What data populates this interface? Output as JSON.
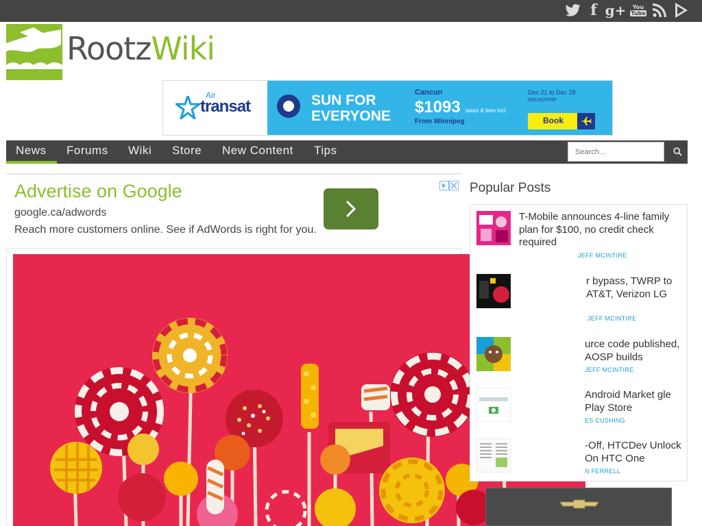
{
  "social": [
    "twitter-icon",
    "facebook-icon",
    "google-plus-icon",
    "youtube-icon",
    "rss-icon",
    "play-store-icon"
  ],
  "social_text": {
    "facebook": "f",
    "google_plus": "g+",
    "youtube_top": "You",
    "youtube_bottom": "Tube"
  },
  "logo": {
    "rootz": "Rootz",
    "wiki": "Wiki"
  },
  "banner": {
    "air": "Air",
    "brand": "transat",
    "headline_1": "SUN FOR",
    "headline_2": "EVERYONE",
    "destination": "Cancun",
    "price": "$1093",
    "price_note": "taxes & fees incl.",
    "origin": "From Winnipeg",
    "dates": "Dec 21 to Dec 28",
    "trip_type": "ROUNDTRIP",
    "button": "Book"
  },
  "nav": {
    "items": [
      "News",
      "Forums",
      "Wiki",
      "Store",
      "New Content",
      "Tips"
    ],
    "active_index": 0,
    "search_placeholder": "Search..."
  },
  "ad": {
    "title": "Advertise on Google",
    "url": "google.ca/adwords",
    "description": "Reach more customers online. See if AdWords is right for you."
  },
  "popular": {
    "title": "Popular Posts",
    "items": [
      {
        "title": "T-Mobile announces 4-line family plan for $100, no credit check required",
        "meta": "JEFF MCINTIRE"
      },
      {
        "title": "r bypass, TWRP to AT&T, Verizon LG",
        "meta": "JEFF MCINTIRE"
      },
      {
        "title": "urce code published, AOSP builds",
        "meta": "JEFF MCINTIRE"
      },
      {
        "title": "Android Market gle Play Store",
        "meta": "ES CUSHING"
      },
      {
        "title": "-Off, HTCDev Unlock On HTC One",
        "meta": "N FERRELL"
      }
    ]
  },
  "colors": {
    "accent": "#8cbe2d",
    "dark": "#444444",
    "link": "#1a9ed8",
    "hero_bg": "#e8274e",
    "banner_blue": "#33b5e8",
    "banner_navy": "#1e3a8a",
    "book_yellow": "#f7ec13"
  }
}
